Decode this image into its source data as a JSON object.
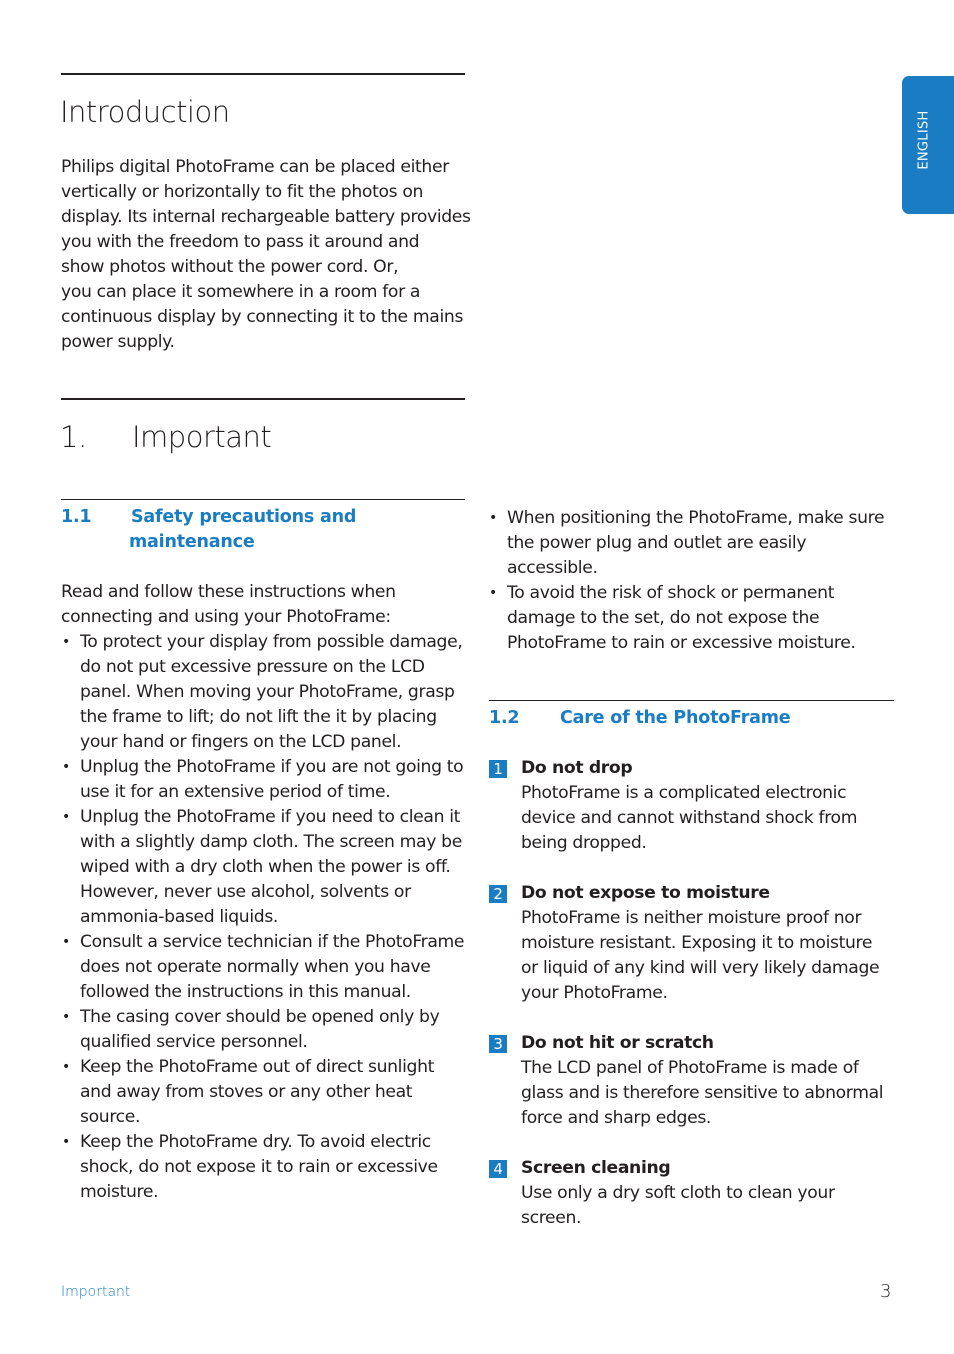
{
  "side_tab": {
    "label": "ENGLISH"
  },
  "intro": {
    "title": "Introduction",
    "paragraph_lines": [
      "Philips digital PhotoFrame can be placed either",
      "vertically or horizontally to fit the photos on",
      "display. Its internal rechargeable battery provides",
      "you with the freedom to pass it around and",
      "show photos without the power cord. Or,",
      "you can place it somewhere in a room for a",
      "continuous display by connecting it to the mains",
      "power supply."
    ]
  },
  "chapter": {
    "number": "1.",
    "title": "Important"
  },
  "section_1_1": {
    "number": "1.1",
    "title_line1": "Safety precautions and",
    "title_line2": "maintenance",
    "intro_lines": [
      "Read and follow these instructions when",
      "connecting and using your PhotoFrame:"
    ],
    "bullets": [
      "To protect your display from possible damage, do not put excessive pressure on the LCD panel. When moving your PhotoFrame, grasp the frame to lift; do not lift the it by placing your hand or fingers on the LCD panel.",
      "Unplug the PhotoFrame if you are not going to use it for an extensive period of time.",
      "Unplug the PhotoFrame if you need to clean it with a slightly damp cloth. The screen may be wiped with a dry cloth when the power is off. However, never use alcohol, solvents or ammonia-based liquids.",
      "Consult a service technician if the PhotoFrame does not operate normally when you have followed the instructions in this manual.",
      "The casing cover should be opened only by qualified service personnel.",
      "Keep the PhotoFrame out of direct sunlight and away from stoves or any other heat source.",
      "Keep the PhotoFrame dry. To avoid electric shock, do not expose it to rain or excessive moisture."
    ],
    "bullets_continued": [
      "When positioning the PhotoFrame, make sure the power plug and outlet are easily accessible.",
      "To avoid the risk of shock or permanent damage to the set, do not expose the PhotoFrame to rain or excessive moisture."
    ]
  },
  "section_1_2": {
    "number": "1.2",
    "title": "Care of the PhotoFrame",
    "items": [
      {
        "num": "1",
        "title": "Do not drop",
        "text": "PhotoFrame is a complicated electronic device and cannot withstand shock from being dropped."
      },
      {
        "num": "2",
        "title": "Do not expose to moisture",
        "text": "PhotoFrame is neither moisture proof nor moisture resistant. Exposing it to moisture or liquid of any kind will very likely damage your PhotoFrame."
      },
      {
        "num": "3",
        "title": "Do not hit or scratch",
        "text": "The LCD panel of PhotoFrame is made of glass and is therefore sensitive to abnormal force and sharp edges."
      },
      {
        "num": "4",
        "title": "Screen cleaning",
        "text": "Use only a dry soft cloth to clean your screen."
      }
    ]
  },
  "footer": {
    "section_label": "Important",
    "page_number": "3"
  },
  "colors": {
    "accent": "#1a7dc4",
    "text": "#231f20"
  }
}
